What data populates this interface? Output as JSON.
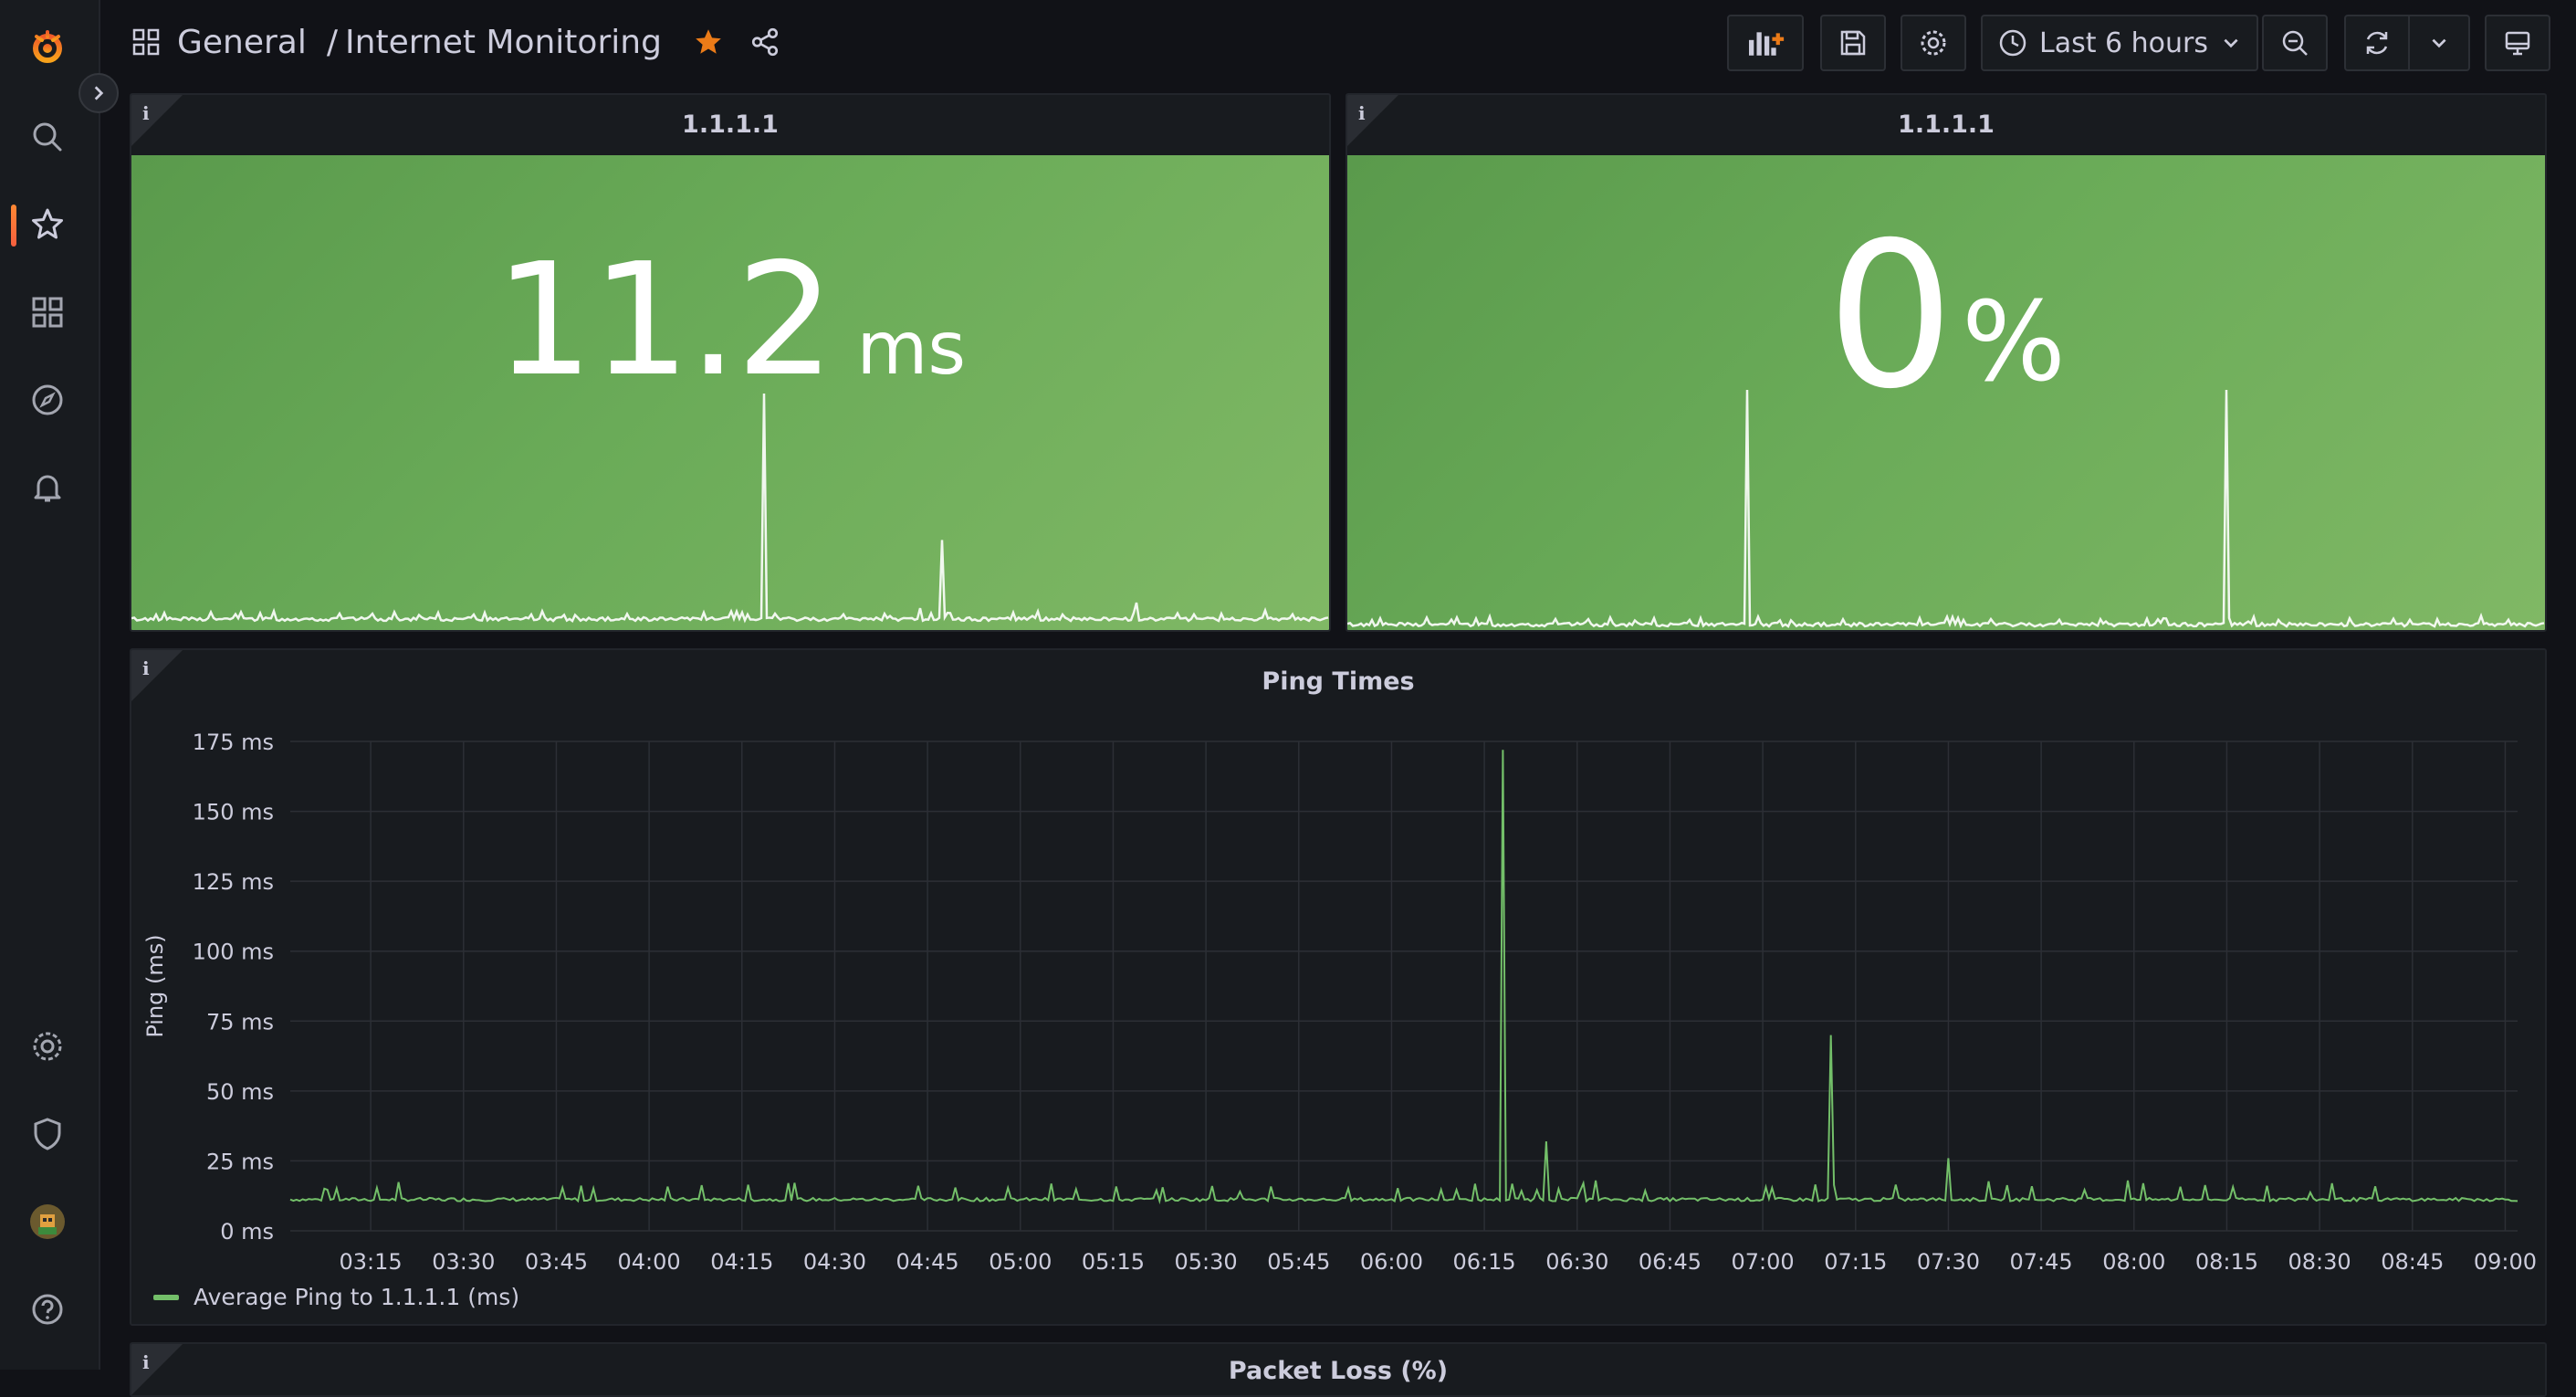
{
  "sidebar": {
    "items": [
      {
        "name": "grafana-logo-icon"
      },
      {
        "name": "search-icon"
      },
      {
        "name": "starred-icon",
        "active": true
      },
      {
        "name": "dashboards-icon"
      },
      {
        "name": "explore-icon"
      },
      {
        "name": "alerting-icon"
      },
      {
        "name": "configuration-icon"
      },
      {
        "name": "server-admin-shield-icon"
      },
      {
        "name": "user-avatar"
      },
      {
        "name": "help-icon"
      }
    ],
    "accent_color": "#f55f3e"
  },
  "header": {
    "folder": "General",
    "separator": "/",
    "dashboard_title": "Internet Monitoring",
    "starred": true,
    "star_color": "#eb7b18",
    "time_range_label": "Last 6 hours"
  },
  "panels": {
    "ping_stat": {
      "title": "1.1.1.1",
      "value": "11.2",
      "unit": "ms",
      "color": "#73bf69"
    },
    "loss_stat": {
      "title": "1.1.1.1",
      "value": "0",
      "unit": "%",
      "color": "#73bf69"
    },
    "ping_times": {
      "title": "Ping Times",
      "legend_label": "Average Ping to 1.1.1.1 (ms)"
    },
    "packet_loss": {
      "title": "Packet Loss (%)"
    }
  },
  "chart_data": {
    "type": "line",
    "title": "Ping Times",
    "xlabel": "",
    "ylabel": "Ping (ms)",
    "ylim": [
      0,
      175
    ],
    "y_ticks": [
      "0 ms",
      "25 ms",
      "50 ms",
      "75 ms",
      "100 ms",
      "125 ms",
      "150 ms",
      "175 ms"
    ],
    "y_tick_values": [
      0,
      25,
      50,
      75,
      100,
      125,
      150,
      175
    ],
    "x_ticks": [
      "03:15",
      "03:30",
      "03:45",
      "04:00",
      "04:15",
      "04:30",
      "04:45",
      "05:00",
      "05:15",
      "05:30",
      "05:45",
      "06:00",
      "06:15",
      "06:30",
      "06:45",
      "07:00",
      "07:15",
      "07:30",
      "07:45",
      "08:00",
      "08:15",
      "08:30",
      "08:45",
      "09:00"
    ],
    "grid": true,
    "legend_position": "bottom-left",
    "series": [
      {
        "name": "Average Ping to 1.1.1.1 (ms)",
        "color": "#73bf69",
        "baseline_ms": 11.2,
        "spikes": [
          {
            "time": "06:18",
            "value": 172
          },
          {
            "time": "06:25",
            "value": 32
          },
          {
            "time": "06:31",
            "value": 17
          },
          {
            "time": "06:33",
            "value": 18
          },
          {
            "time": "07:11",
            "value": 70
          },
          {
            "time": "07:30",
            "value": 26
          },
          {
            "time": "07:59",
            "value": 18
          },
          {
            "time": "05:31",
            "value": 16
          },
          {
            "time": "08:32",
            "value": 17
          }
        ]
      }
    ]
  }
}
